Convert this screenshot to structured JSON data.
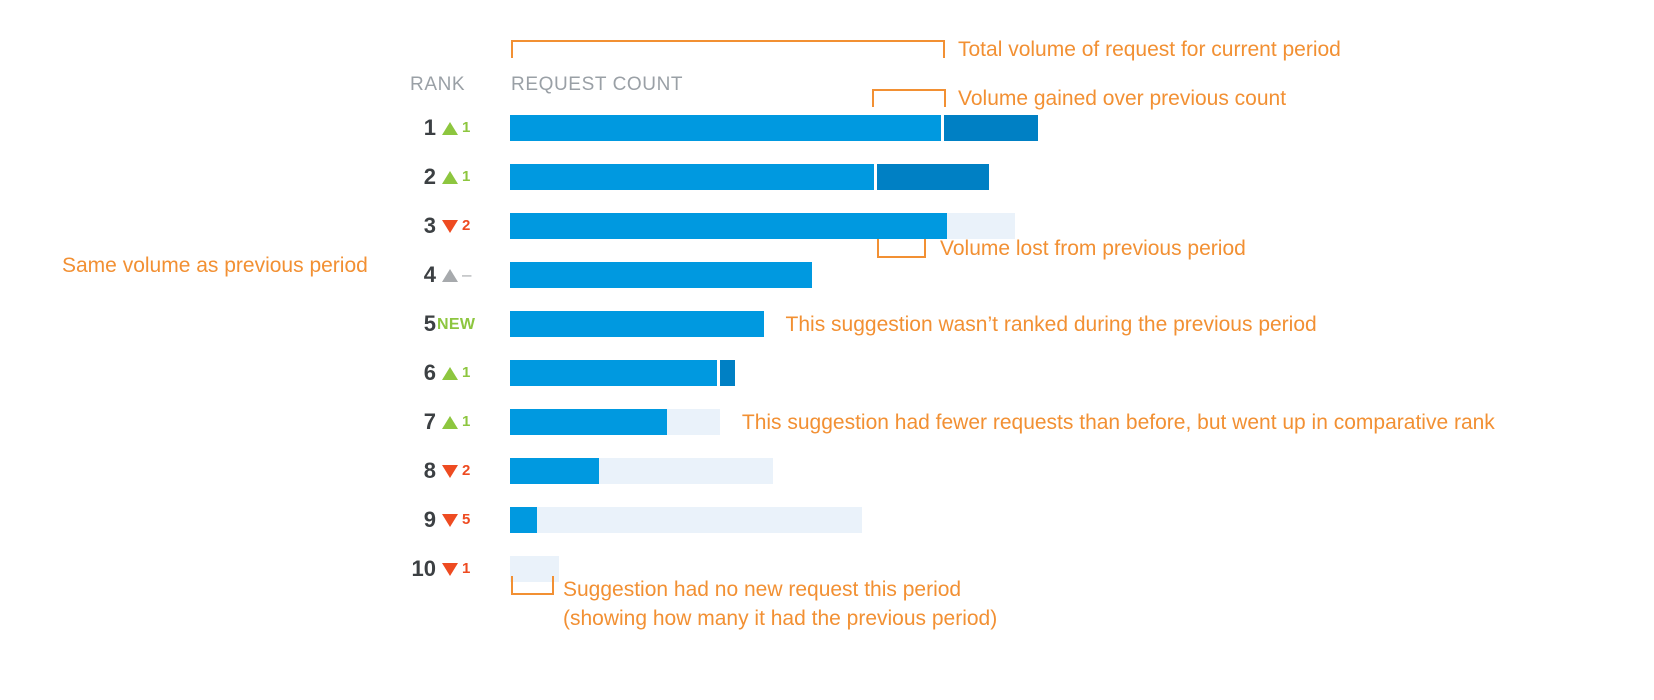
{
  "headers": {
    "rank": "RANK",
    "request_count": "REQUEST COUNT"
  },
  "colors": {
    "current_volume": "#0099E0",
    "gained_volume": "#0080C4",
    "lost_volume": "#EAF2FA",
    "annotation": "#F29033",
    "rank_up": "#8DC63F",
    "rank_down": "#EE4B21",
    "rank_same": "#A7AAAD",
    "header_text": "#9AA0A6",
    "rank_number": "#3C4043"
  },
  "annotations": {
    "total_volume": "Total volume of request for current period",
    "volume_gained": "Volume gained over previous count",
    "volume_lost": "Volume lost from previous period",
    "same_volume": "Same volume as previous period",
    "new_suggestion": "This suggestion wasn’t ranked during the previous period",
    "fewer_requests": "This suggestion had fewer requests than before, but went up in comparative rank",
    "no_new_request_line1": "Suggestion had no new request this period",
    "no_new_request_line2": "(showing how many it had the previous period)"
  },
  "chart_data": {
    "type": "bar",
    "title": "",
    "xlabel": "REQUEST COUNT",
    "ylabel": "RANK",
    "grid": false,
    "legend": [
      {
        "name": "Total volume of request for current period",
        "color": "#0099E0"
      },
      {
        "name": "Volume gained over previous count",
        "color": "#0080C4"
      },
      {
        "name": "Volume lost from previous period",
        "color": "#EAF2FA"
      }
    ],
    "categories": [
      "1",
      "2",
      "3",
      "4",
      "5",
      "6",
      "7",
      "8",
      "9",
      "10"
    ],
    "series": [
      {
        "name": "current",
        "values": [
          355,
          300,
          360,
          249,
          209,
          171,
          129,
          73,
          22,
          0
        ]
      },
      {
        "name": "gained",
        "values": [
          78,
          92,
          0,
          0,
          0,
          12,
          0,
          0,
          0,
          0
        ]
      },
      {
        "name": "lost",
        "values": [
          0,
          0,
          56,
          0,
          0,
          0,
          44,
          144,
          268,
          40
        ]
      }
    ],
    "rows": [
      {
        "rank": "1",
        "delta_direction": "up",
        "delta_value": "1",
        "current": 355,
        "gained": 78,
        "lost": 0,
        "note": ""
      },
      {
        "rank": "2",
        "delta_direction": "up",
        "delta_value": "1",
        "current": 300,
        "gained": 92,
        "lost": 0,
        "note": ""
      },
      {
        "rank": "3",
        "delta_direction": "down",
        "delta_value": "2",
        "current": 360,
        "gained": 0,
        "lost": 56,
        "note": ""
      },
      {
        "rank": "4",
        "delta_direction": "flat",
        "delta_value": "–",
        "current": 249,
        "gained": 0,
        "lost": 0,
        "note": ""
      },
      {
        "rank": "5",
        "delta_direction": "new",
        "delta_value": "NEW",
        "current": 209,
        "gained": 0,
        "lost": 0,
        "note": "This suggestion wasn’t ranked during the previous period"
      },
      {
        "rank": "6",
        "delta_direction": "up",
        "delta_value": "1",
        "current": 171,
        "gained": 12,
        "lost": 0,
        "note": ""
      },
      {
        "rank": "7",
        "delta_direction": "up",
        "delta_value": "1",
        "current": 129,
        "gained": 0,
        "lost": 44,
        "note": "This suggestion had fewer requests than before, but went up in comparative rank"
      },
      {
        "rank": "8",
        "delta_direction": "down",
        "delta_value": "2",
        "current": 73,
        "gained": 0,
        "lost": 144,
        "note": ""
      },
      {
        "rank": "9",
        "delta_direction": "down",
        "delta_value": "5",
        "current": 22,
        "gained": 0,
        "lost": 268,
        "note": ""
      },
      {
        "rank": "10",
        "delta_direction": "down",
        "delta_value": "1",
        "current": 0,
        "gained": 0,
        "lost": 40,
        "note": ""
      }
    ]
  }
}
